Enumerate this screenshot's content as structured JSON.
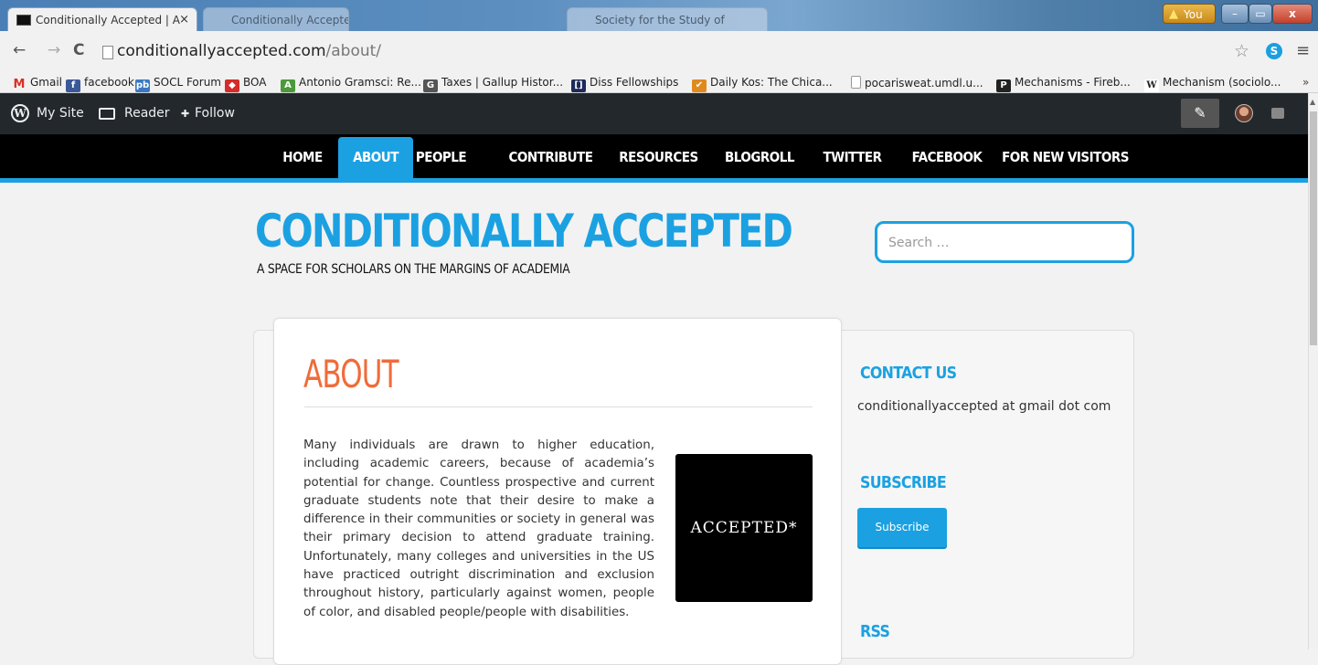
{
  "browser": {
    "active_tab": "Conditionally Accepted | A",
    "tab_close": "×",
    "inactive_tabs": [
      "Conditionally Accepted",
      "Society for the Study of"
    ],
    "you_label": "You",
    "url_host": "conditionallyaccepted.com",
    "url_path": "/about/",
    "minimize": "–",
    "maximize": "▭",
    "close": "x"
  },
  "bookmarks": [
    {
      "label": "Gmail",
      "icon": "gmail-icon",
      "color": "#d93025",
      "glyph": "M"
    },
    {
      "label": "facebook",
      "icon": "facebook-icon",
      "color": "#3b5998",
      "glyph": "f"
    },
    {
      "label": "SOCL Forum",
      "icon": "socl-icon",
      "color": "#3a78c3",
      "glyph": "pb"
    },
    {
      "label": "BOA",
      "icon": "boa-icon",
      "color": "#d62b2b",
      "glyph": "◆"
    },
    {
      "label": "Antonio Gramsci: Re...",
      "icon": "gramsci-icon",
      "color": "#4a9a3a",
      "glyph": "A"
    },
    {
      "label": "Taxes | Gallup Histor...",
      "icon": "gallup-icon",
      "color": "#555555",
      "glyph": "G"
    },
    {
      "label": "Diss Fellowships",
      "icon": "fellowships-icon",
      "color": "#1d2a5a",
      "glyph": "[]"
    },
    {
      "label": "Daily Kos: The Chica...",
      "icon": "dailykos-icon",
      "color": "#e08a1e",
      "glyph": "✔"
    },
    {
      "label": "pocarisweat.umdl.u...",
      "icon": "page-icon",
      "color": "#bbbbbb",
      "glyph": ""
    },
    {
      "label": "Mechanisms - Fireb...",
      "icon": "mechanisms-icon",
      "color": "#222222",
      "glyph": "P"
    },
    {
      "label": "Mechanism (sociolo...",
      "icon": "wikipedia-icon",
      "color": "#ffffff",
      "glyph": "W"
    }
  ],
  "bookmarks_more": "»",
  "wp_bar": {
    "my_site": "My Site",
    "reader": "Reader",
    "follow": "Follow"
  },
  "nav": [
    {
      "label": "HOME",
      "active": false
    },
    {
      "label": "ABOUT",
      "active": true
    },
    {
      "label": "PEOPLE",
      "active": false
    },
    {
      "label": "CONTRIBUTE",
      "active": false
    },
    {
      "label": "RESOURCES",
      "active": false
    },
    {
      "label": "BLOGROLL",
      "active": false
    },
    {
      "label": "TWITTER",
      "active": false
    },
    {
      "label": "FACEBOOK",
      "active": false
    },
    {
      "label": "FOR NEW VISITORS",
      "active": false
    }
  ],
  "site": {
    "title": "CONDITIONALLY ACCEPTED",
    "tagline": "A SPACE FOR SCHOLARS ON THE MARGINS OF ACADEMIA",
    "search_placeholder": "Search …"
  },
  "post": {
    "title": "ABOUT",
    "body": "Many individuals are drawn to higher education, including academic careers, because of academia’s potential for change.  Countless prospective and current graduate students note that their desire to make a difference in their communities or society in general was their primary decision to attend graduate training.  Unfortunately, many colleges and universities in the US have practiced outright discrimination and exclusion throughout history, particularly against women, people of color, and disabled people/people with disabilities.",
    "image_text": "ACCEPTED*"
  },
  "sidebar": {
    "contact_title": "CONTACT US",
    "contact_text": "conditionallyaccepted at gmail dot com",
    "subscribe_title": "SUBSCRIBE",
    "subscribe_button": "Subscribe",
    "rss_title": "RSS"
  },
  "colors": {
    "accent": "#1ba1e2",
    "title_orange": "#ef6c3a",
    "nav_bg": "#000000",
    "wp_bar": "#23282d"
  }
}
